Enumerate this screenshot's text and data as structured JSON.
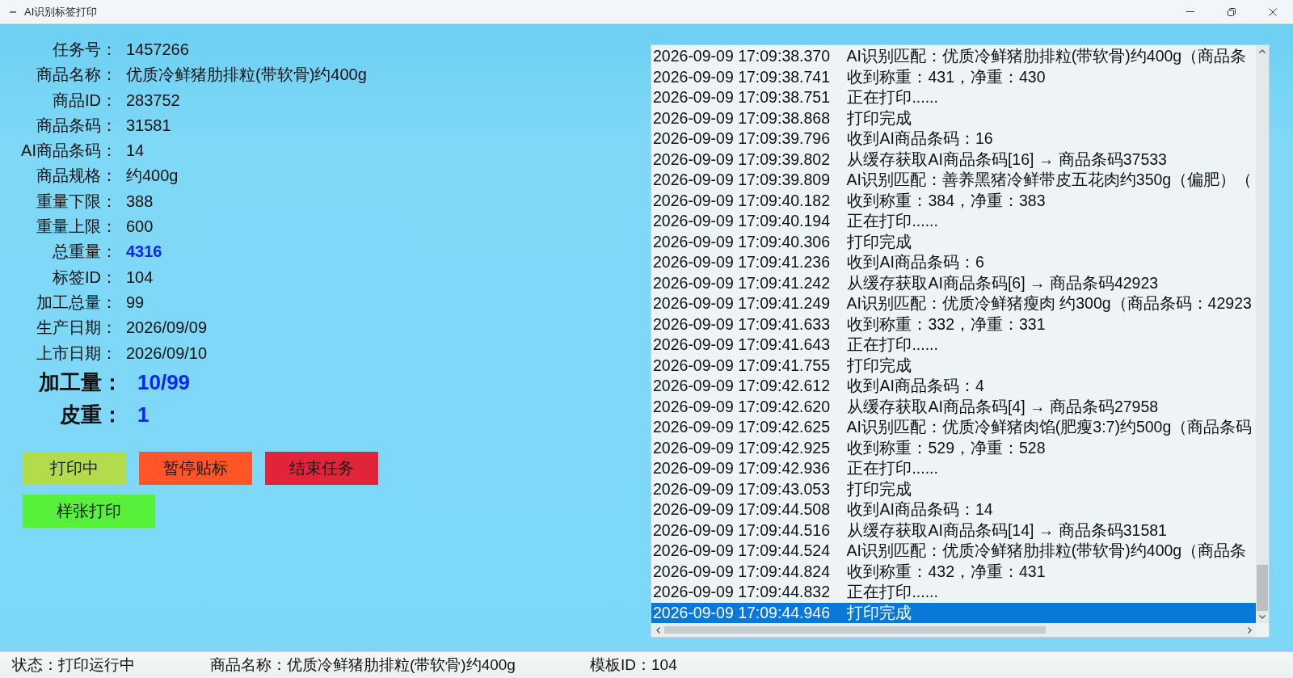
{
  "window": {
    "title": "AI识别标签打印"
  },
  "task_info": {
    "fields": [
      {
        "label": "任务号：",
        "value": "1457266",
        "kind": "normal"
      },
      {
        "label": "商品名称：",
        "value": "优质冷鲜猪肋排粒(带软骨)约400g",
        "kind": "normal"
      },
      {
        "label": "商品ID：",
        "value": "283752",
        "kind": "normal"
      },
      {
        "label": "商品条码：",
        "value": "31581",
        "kind": "normal"
      },
      {
        "label": "AI商品条码：",
        "value": "14",
        "kind": "normal"
      },
      {
        "label": "商品规格：",
        "value": "约400g",
        "kind": "normal"
      },
      {
        "label": "重量下限：",
        "value": "388",
        "kind": "normal"
      },
      {
        "label": "重量上限：",
        "value": "600",
        "kind": "normal"
      },
      {
        "label": "总重量：",
        "value": "4316",
        "kind": "emphasis"
      },
      {
        "label": "标签ID：",
        "value": "104",
        "kind": "normal"
      },
      {
        "label": "加工总量：",
        "value": "99",
        "kind": "normal"
      },
      {
        "label": "生产日期：",
        "value": "2026/09/09",
        "kind": "normal"
      },
      {
        "label": "上市日期：",
        "value": "2026/09/10",
        "kind": "normal"
      }
    ],
    "totals": [
      {
        "label": "加工量：",
        "value": "10/99"
      },
      {
        "label": "皮重：",
        "value": "1"
      }
    ]
  },
  "button_rows": [
    {
      "buttons": [
        {
          "label": "打印中",
          "color": "#b3dc4c"
        },
        {
          "label": "暂停贴标",
          "color": "#ff5528"
        },
        {
          "label": "结束任务",
          "color": "#e2243a"
        }
      ]
    },
    {
      "buttons": [
        {
          "label": "样张打印",
          "color": "#57f03a"
        }
      ]
    }
  ],
  "log": {
    "entries": [
      {
        "time": "2026-09-09 17:09:38.370",
        "message": "AI识别匹配：优质冷鲜猪肋排粒(带软骨)约400g（商品条",
        "selected": false
      },
      {
        "time": "2026-09-09 17:09:38.741",
        "message": "收到称重：431，净重：430",
        "selected": false
      },
      {
        "time": "2026-09-09 17:09:38.751",
        "message": "正在打印......",
        "selected": false
      },
      {
        "time": "2026-09-09 17:09:38.868",
        "message": "打印完成",
        "selected": false
      },
      {
        "time": "2026-09-09 17:09:39.796",
        "message": "收到AI商品条码：16",
        "selected": false
      },
      {
        "time": "2026-09-09 17:09:39.802",
        "message": "从缓存获取AI商品条码[16] → 商品条码37533",
        "selected": false
      },
      {
        "time": "2026-09-09 17:09:39.809",
        "message": "AI识别匹配：善养黑猪冷鲜带皮五花肉约350g（偏肥）（",
        "selected": false
      },
      {
        "time": "2026-09-09 17:09:40.182",
        "message": "收到称重：384，净重：383",
        "selected": false
      },
      {
        "time": "2026-09-09 17:09:40.194",
        "message": "正在打印......",
        "selected": false
      },
      {
        "time": "2026-09-09 17:09:40.306",
        "message": "打印完成",
        "selected": false
      },
      {
        "time": "2026-09-09 17:09:41.236",
        "message": "收到AI商品条码：6",
        "selected": false
      },
      {
        "time": "2026-09-09 17:09:41.242",
        "message": "从缓存获取AI商品条码[6] → 商品条码42923",
        "selected": false
      },
      {
        "time": "2026-09-09 17:09:41.249",
        "message": "AI识别匹配：优质冷鲜猪瘦肉 约300g（商品条码：42923",
        "selected": false
      },
      {
        "time": "2026-09-09 17:09:41.633",
        "message": "收到称重：332，净重：331",
        "selected": false
      },
      {
        "time": "2026-09-09 17:09:41.643",
        "message": "正在打印......",
        "selected": false
      },
      {
        "time": "2026-09-09 17:09:41.755",
        "message": "打印完成",
        "selected": false
      },
      {
        "time": "2026-09-09 17:09:42.612",
        "message": "收到AI商品条码：4",
        "selected": false
      },
      {
        "time": "2026-09-09 17:09:42.620",
        "message": "从缓存获取AI商品条码[4] → 商品条码27958",
        "selected": false
      },
      {
        "time": "2026-09-09 17:09:42.625",
        "message": "AI识别匹配：优质冷鲜猪肉馅(肥瘦3:7)约500g（商品条码",
        "selected": false
      },
      {
        "time": "2026-09-09 17:09:42.925",
        "message": "收到称重：529，净重：528",
        "selected": false
      },
      {
        "time": "2026-09-09 17:09:42.936",
        "message": "正在打印......",
        "selected": false
      },
      {
        "time": "2026-09-09 17:09:43.053",
        "message": "打印完成",
        "selected": false
      },
      {
        "time": "2026-09-09 17:09:44.508",
        "message": "收到AI商品条码：14",
        "selected": false
      },
      {
        "time": "2026-09-09 17:09:44.516",
        "message": "从缓存获取AI商品条码[14] → 商品条码31581",
        "selected": false
      },
      {
        "time": "2026-09-09 17:09:44.524",
        "message": "AI识别匹配：优质冷鲜猪肋排粒(带软骨)约400g（商品条",
        "selected": false
      },
      {
        "time": "2026-09-09 17:09:44.824",
        "message": "收到称重：432，净重：431",
        "selected": false
      },
      {
        "time": "2026-09-09 17:09:44.832",
        "message": "正在打印......",
        "selected": false
      },
      {
        "time": "2026-09-09 17:09:44.946",
        "message": "打印完成",
        "selected": true
      }
    ]
  },
  "status_bar": {
    "items": [
      "状态：打印运行中",
      "商品名称：优质冷鲜猪肋排粒(带软骨)约400g",
      "模板ID：104"
    ]
  }
}
